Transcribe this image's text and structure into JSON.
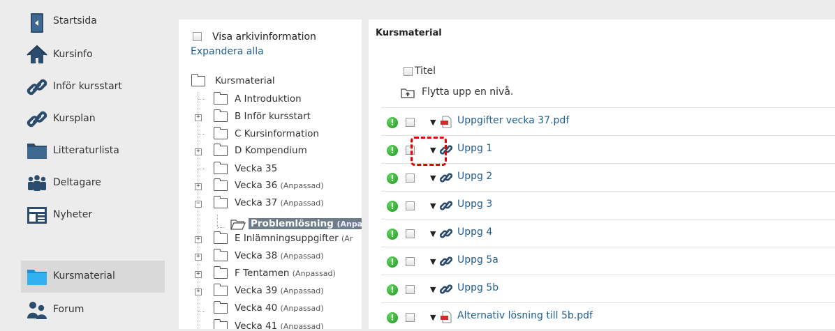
{
  "nav": {
    "items": [
      {
        "label": "Startsida",
        "icon": "door-icon"
      },
      {
        "label": "Kursinfo",
        "icon": "house-icon"
      },
      {
        "label": "Inför kursstart",
        "icon": "link-icon"
      },
      {
        "label": "Kursplan",
        "icon": "link-icon"
      },
      {
        "label": "Litteraturlista",
        "icon": "folder-icon"
      },
      {
        "label": "Deltagare",
        "icon": "people-icon"
      },
      {
        "label": "Nyheter",
        "icon": "news-icon"
      },
      {
        "label": "Kursmaterial",
        "icon": "folder-open-icon",
        "active": true
      },
      {
        "label": "Forum",
        "icon": "forum-icon"
      }
    ]
  },
  "tree": {
    "archive_label": "Visa arkivinformation",
    "expand_all": "Expandera alla",
    "root": "Kursmaterial",
    "nodes": [
      {
        "label": "A Introduktion",
        "sub": ""
      },
      {
        "label": "B Inför kursstart",
        "sub": ""
      },
      {
        "label": "C Kursinformation",
        "sub": ""
      },
      {
        "label": "D Kompendium",
        "sub": ""
      },
      {
        "label": "Vecka 35",
        "sub": ""
      },
      {
        "label": "Vecka 36",
        "sub": "(Anpassad)"
      },
      {
        "label": "Vecka 37",
        "sub": "(Anpassad)"
      },
      {
        "label": "Problemlösning",
        "sub": "(Anpa"
      },
      {
        "label": "E Inlämningsuppgifter",
        "sub": "(Ar"
      },
      {
        "label": "Vecka 38",
        "sub": "(Anpassad)"
      },
      {
        "label": "F Tentamen",
        "sub": "(Anpassad)"
      },
      {
        "label": "Vecka 39",
        "sub": "(Anpassad)"
      },
      {
        "label": "Vecka 40",
        "sub": "(Anpassad)"
      },
      {
        "label": "Vecka 41",
        "sub": "(Anpassad)"
      }
    ]
  },
  "content": {
    "title": "Kursmaterial",
    "column_title": "Titel",
    "up_level": "Flytta upp en nivå.",
    "rows": [
      {
        "name": "Uppgifter vecka 37.pdf",
        "type": "pdf"
      },
      {
        "name": "Uppg 1",
        "type": "link"
      },
      {
        "name": "Uppg 2",
        "type": "link"
      },
      {
        "name": "Uppg 3",
        "type": "link"
      },
      {
        "name": "Uppg 4",
        "type": "link"
      },
      {
        "name": "Uppg 5a",
        "type": "link"
      },
      {
        "name": "Uppg 5b",
        "type": "link"
      },
      {
        "name": "Alternativ lösning till 5b.pdf",
        "type": "pdf"
      }
    ]
  },
  "colors": {
    "link": "#1f5f8f",
    "alert": "#1d9a1d",
    "highlight": "#e00000",
    "selected": "#6e7c8c"
  }
}
